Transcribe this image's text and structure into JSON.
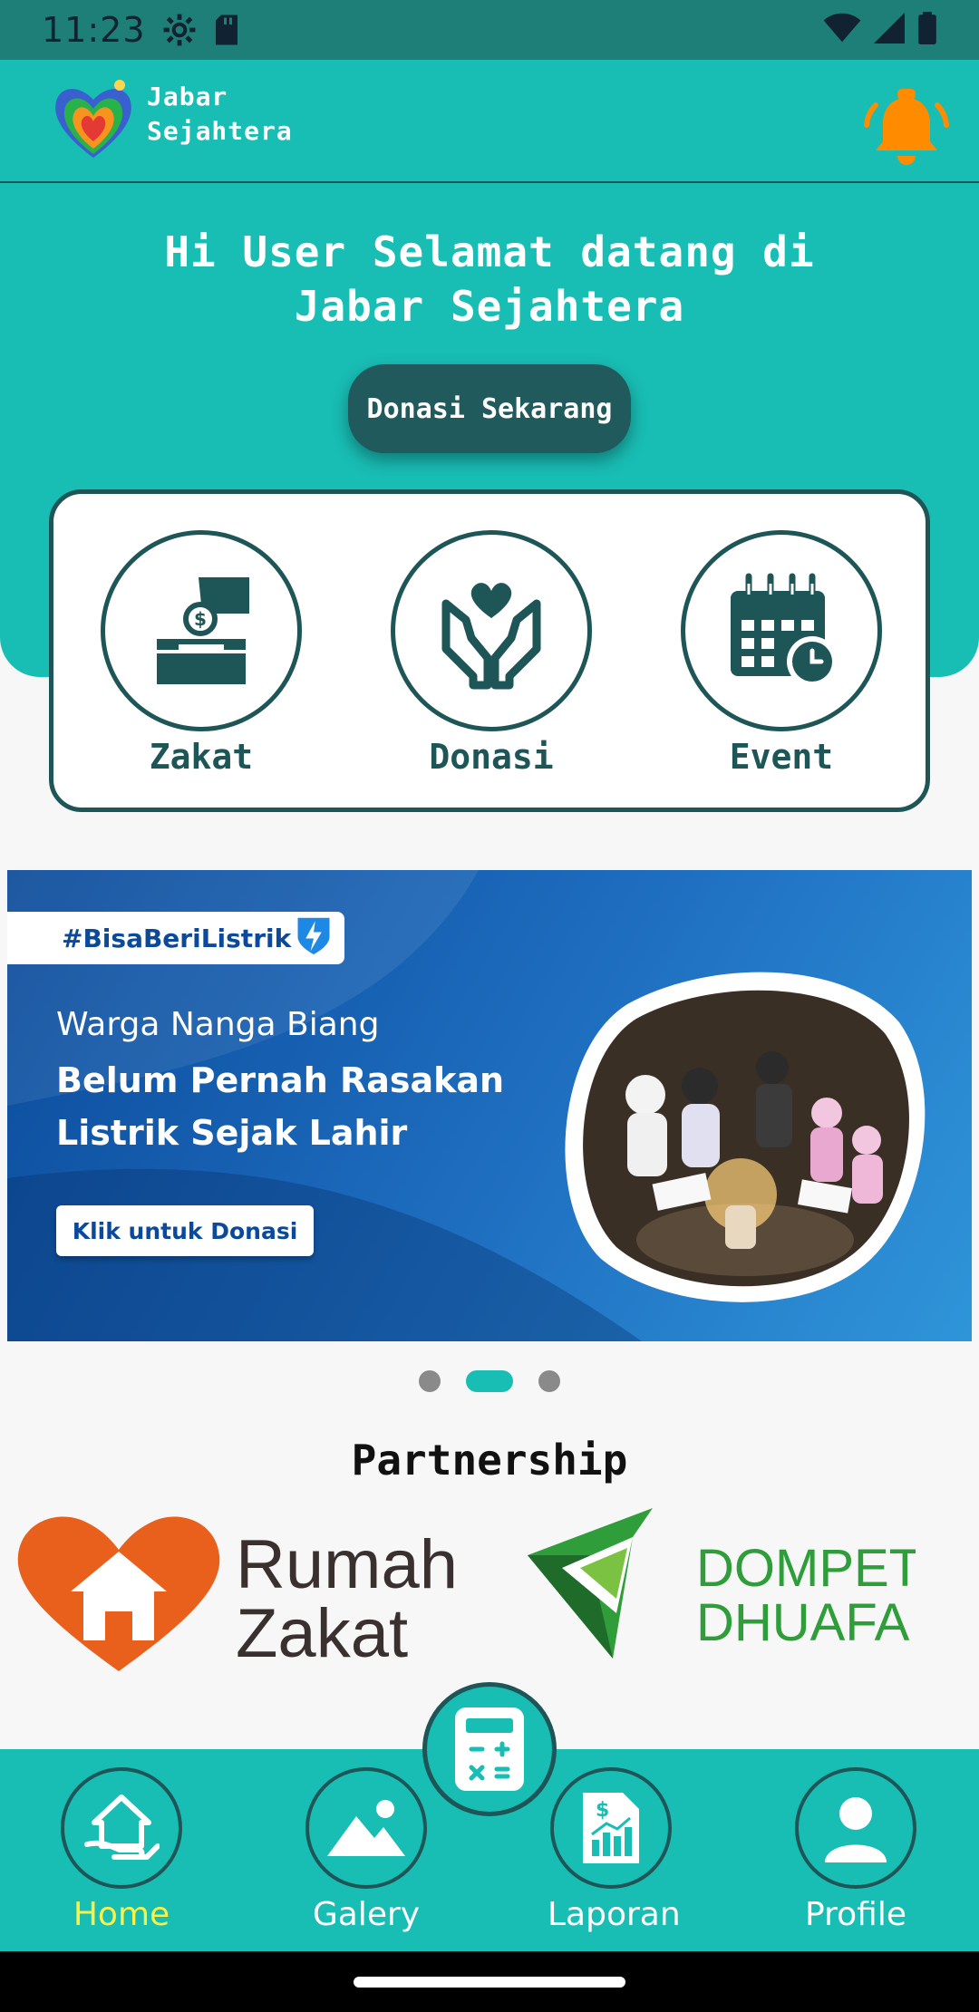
{
  "status_bar": {
    "time": "11:23"
  },
  "header": {
    "brand_line1": "Jabar",
    "brand_line2": "Sejahtera"
  },
  "hero": {
    "greeting_line1": "Hi User Selamat datang di",
    "greeting_line2": "Jabar Sejahtera",
    "donate_button": "Donasi Sekarang"
  },
  "menu": [
    {
      "label": "Zakat",
      "icon": "zakat-box-icon"
    },
    {
      "label": "Donasi",
      "icon": "heart-hands-icon"
    },
    {
      "label": "Event",
      "icon": "calendar-clock-icon"
    }
  ],
  "banner": {
    "tag": "#BisaBeriListrik",
    "line1": "Warga Nanga Biang",
    "line2": "Belum Pernah Rasakan",
    "line3": "Listrik Sejak Lahir",
    "cta": "Klik untuk Donasi"
  },
  "carousel": {
    "count": 3,
    "active_index": 1
  },
  "partnership": {
    "title": "Partnership",
    "partners": [
      {
        "line1": "Rumah",
        "line2": "Zakat"
      },
      {
        "line1": "DOMPET",
        "line2": "DHUAFA"
      }
    ]
  },
  "bottom_nav": {
    "items": [
      {
        "label": "Home",
        "icon": "home-hand-icon",
        "active": true
      },
      {
        "label": "Galery",
        "icon": "mountain-image-icon",
        "active": false
      },
      {
        "label": "Laporan",
        "icon": "report-chart-icon",
        "active": false
      },
      {
        "label": "Profile",
        "icon": "user-icon",
        "active": false
      }
    ],
    "fab_icon": "calculator-icon"
  },
  "colors": {
    "primary": "#18bdb4",
    "dark": "#1e5556",
    "accent": "#f6f34a",
    "bell": "#ff8c00"
  }
}
